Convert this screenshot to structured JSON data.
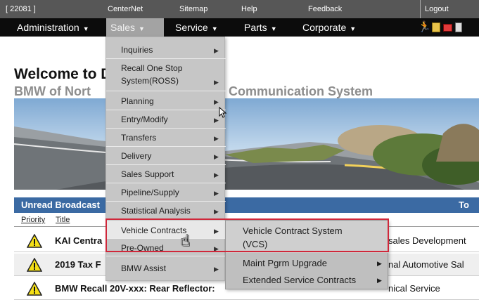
{
  "topbar": {
    "code": "[ 22081 ]",
    "links": [
      "CenterNet",
      "Sitemap",
      "Help",
      "Feedback"
    ],
    "logout": "Logout"
  },
  "nav": {
    "items": [
      {
        "label": "Administration"
      },
      {
        "label": "Sales"
      },
      {
        "label": "Service"
      },
      {
        "label": "Parts"
      },
      {
        "label": "Corporate"
      }
    ],
    "icons": [
      "runner-icon",
      "note-icon",
      "mail-icon",
      "document-icon"
    ]
  },
  "welcome": {
    "line1": "Welcome to D",
    "line2_left": "BMW of Nort",
    "line2_right": "Communication System"
  },
  "broadcast": {
    "header_left": "Unread Broadcast",
    "header_right": "To",
    "columns": [
      "Priority",
      "Title"
    ],
    "rows": [
      {
        "title": "KAI Centra",
        "dept": "sales Development"
      },
      {
        "title": "2019 Tax F",
        "dept": "nal Automotive Sal"
      },
      {
        "title": "BMW Recall 20V-xxx: Rear Reflector:",
        "dept": "nical Service"
      }
    ]
  },
  "sales_menu": {
    "items": [
      {
        "label": "Inquiries"
      },
      {
        "label": "Recall One Stop",
        "label2": "System(ROSS)"
      },
      {
        "label": "Planning"
      },
      {
        "label": "Entry/Modify"
      },
      {
        "label": "Transfers"
      },
      {
        "label": "Delivery"
      },
      {
        "label": "Sales Support"
      },
      {
        "label": "Pipeline/Supply"
      },
      {
        "label": "Statistical Analysis"
      },
      {
        "label": "Vehicle Contracts"
      },
      {
        "label": "Pre-Owned"
      },
      {
        "label": "BMW Assist"
      }
    ]
  },
  "vehicle_contracts_submenu": {
    "items": [
      {
        "label": "Vehicle Contract System",
        "label2": "(VCS)"
      },
      {
        "label": "Maint Pgrm Upgrade"
      },
      {
        "label": "Extended Service Contracts"
      }
    ]
  },
  "colors": {
    "topbar": "#575757",
    "nav": "#0c0c0c",
    "accent_blue": "#3b6aa3",
    "highlight_red": "#d0273a"
  }
}
